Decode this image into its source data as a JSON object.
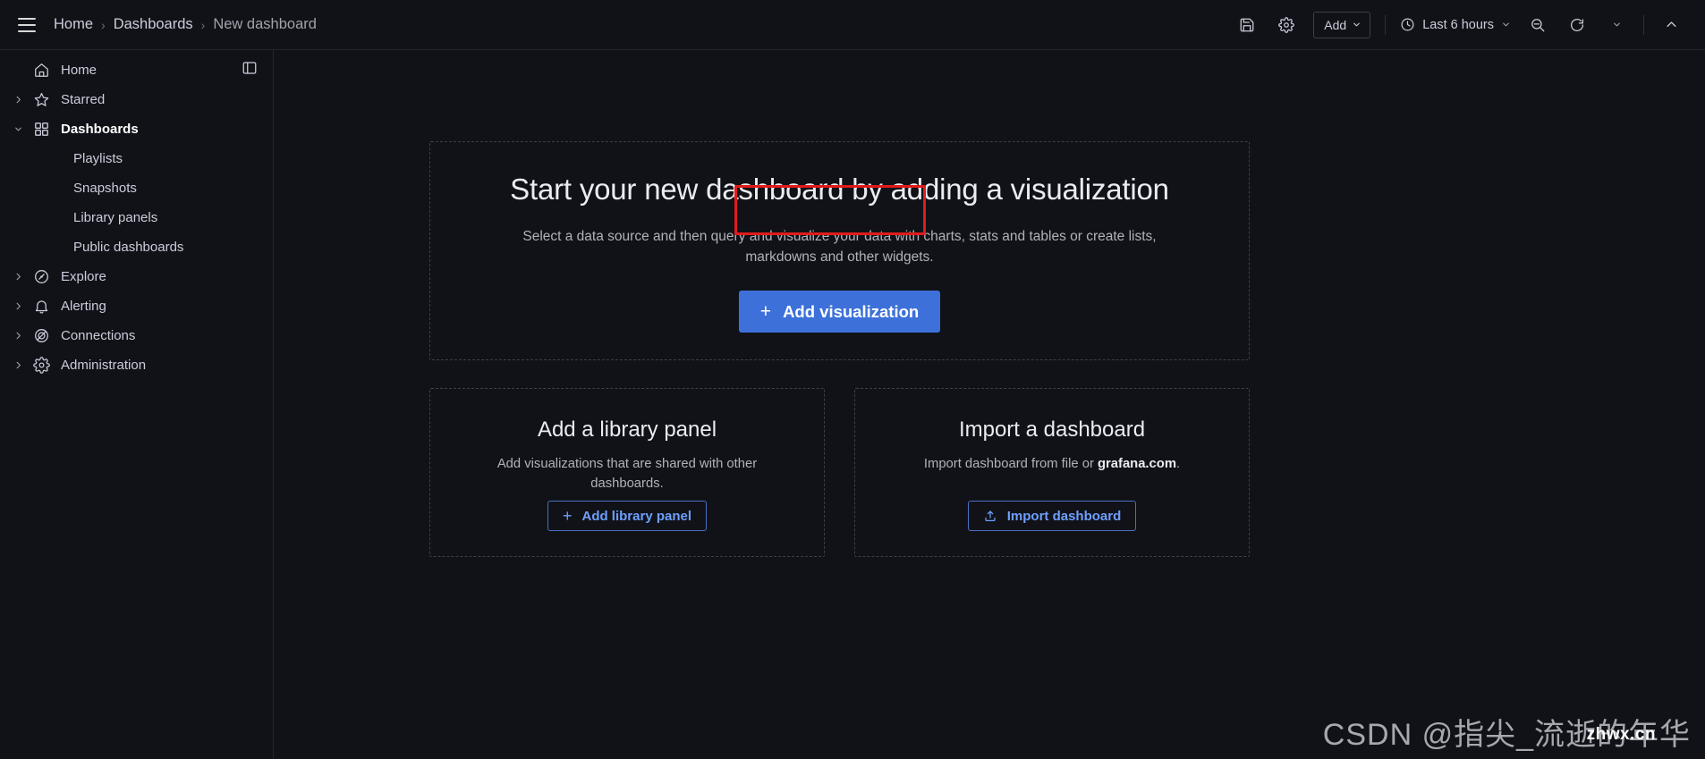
{
  "topbar": {
    "menu_icon": "hamburger-icon",
    "breadcrumb": {
      "home": "Home",
      "dashboards": "Dashboards",
      "current": "New dashboard",
      "separator": "›"
    },
    "save_icon": "save-disk-icon",
    "settings_icon": "gear-icon",
    "add_label": "Add",
    "add_chevron": "⌄",
    "time_icon": "clock-icon",
    "time_range": "Last 6 hours",
    "time_chevron": "⌄",
    "zoom_out_icon": "zoom-out-icon",
    "refresh_icon": "refresh-icon",
    "refresh_chevron": "⌄",
    "collapse_icon": "chevron-up-icon"
  },
  "sidebar": {
    "dock_icon": "dock-menu-icon",
    "items": [
      {
        "label": "Home",
        "icon": "home-icon",
        "expandable": false,
        "active": false
      },
      {
        "label": "Starred",
        "icon": "star-icon",
        "expandable": true,
        "expanded": false,
        "active": false
      },
      {
        "label": "Dashboards",
        "icon": "apps-grid-icon",
        "expandable": true,
        "expanded": true,
        "active": true
      },
      {
        "label": "Explore",
        "icon": "compass-icon",
        "expandable": true,
        "expanded": false,
        "active": false
      },
      {
        "label": "Alerting",
        "icon": "bell-icon",
        "expandable": true,
        "expanded": false,
        "active": false
      },
      {
        "label": "Connections",
        "icon": "connections-icon",
        "expandable": true,
        "expanded": false,
        "active": false
      },
      {
        "label": "Administration",
        "icon": "gear-icon",
        "expandable": true,
        "expanded": false,
        "active": false
      }
    ],
    "dashboard_children": [
      {
        "label": "Playlists"
      },
      {
        "label": "Snapshots"
      },
      {
        "label": "Library panels"
      },
      {
        "label": "Public dashboards"
      }
    ],
    "chevron_collapsed": "›",
    "chevron_expanded": "⌄"
  },
  "main": {
    "hero": {
      "title": "Start your new dashboard by adding a visualization",
      "description": "Select a data source and then query and visualize your data with charts, stats and tables or create lists, markdowns and other widgets.",
      "button_label": "Add visualization",
      "button_plus": "+",
      "button_color": "#3d71d9",
      "highlight_color": "#e01b1b"
    },
    "cards": [
      {
        "title": "Add a library panel",
        "description": "Add visualizations that are shared with other dashboards.",
        "button_label": "Add library panel",
        "button_plus": "+",
        "button_icon": "plus-icon"
      },
      {
        "title": "Import a dashboard",
        "description_prefix": "Import dashboard from file or ",
        "description_strong": "grafana.com",
        "description_suffix": ".",
        "button_label": "Import dashboard",
        "button_icon": "upload-icon"
      }
    ]
  },
  "watermark": {
    "text": "CSDN @指尖_流逝的年华",
    "sub_text": "zhwx.cn"
  },
  "colors": {
    "background": "#111217",
    "border": "#24262e",
    "accent_blue": "#3d71d9",
    "link_blue": "#6e9fff",
    "text_primary": "#ccccdc",
    "text_muted": "#9fa3ad",
    "highlight_red": "#e01b1b"
  }
}
